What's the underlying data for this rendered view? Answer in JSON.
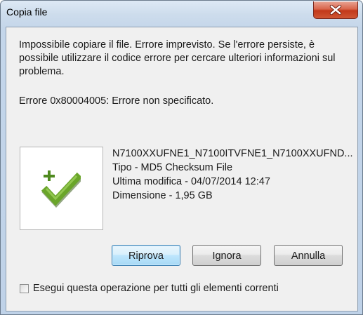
{
  "window": {
    "title": "Copia file"
  },
  "message": {
    "body": "Impossibile copiare il file. Errore imprevisto. Se l'errore persiste, è possibile utilizzare il codice errore per cercare ulteriori informazioni sul problema.",
    "error_code": "Errore 0x80004005: Errore non specificato."
  },
  "file": {
    "icon": "green-checkmark-plus-icon",
    "name": "N7100XXUFNE1_N7100ITVFNE1_N7100XXUFND...",
    "type": "Tipo - MD5 Checksum File",
    "modified": "Ultima modifica - 04/07/2014 12:47",
    "size": "Dimensione - 1,95 GB"
  },
  "buttons": {
    "retry": "Riprova",
    "ignore": "Ignora",
    "cancel": "Annulla"
  },
  "apply_all": {
    "label": "Esegui questa operazione per tutti gli elementi correnti",
    "checked": false
  },
  "colors": {
    "close_button": "#c7472a",
    "check_green": "#6aa52a"
  }
}
